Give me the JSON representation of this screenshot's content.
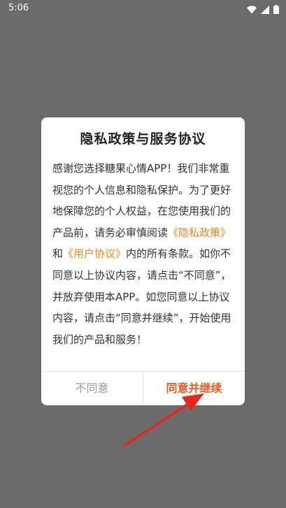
{
  "status_bar": {
    "time": "5:06"
  },
  "dialog": {
    "title": "隐私政策与服务协议",
    "body_part1": "感谢您选择糖果心情APP！我们非常重视您的个人信息和隐私保护。为了更好地保障您的个人权益，在您使用我们的产品前，请务必审慎阅读",
    "privacy_policy_link": "《隐私政策》",
    "and_text": "和",
    "user_agreement_link": "《用户协议》",
    "body_part2": "内的所有条款。如你不同意以上协议内容，请点击“不同意”，并放弃使用本APP。如您同意以上协议内容，请点击“同意并继续”，开始使用我们的产品和服务！",
    "disagree_label": "不同意",
    "agree_label": "同意并继续"
  },
  "colors": {
    "overlay": "#6b6b6b",
    "link": "#f5851f",
    "agree": "#f25a22",
    "arrow": "#e8261c"
  }
}
